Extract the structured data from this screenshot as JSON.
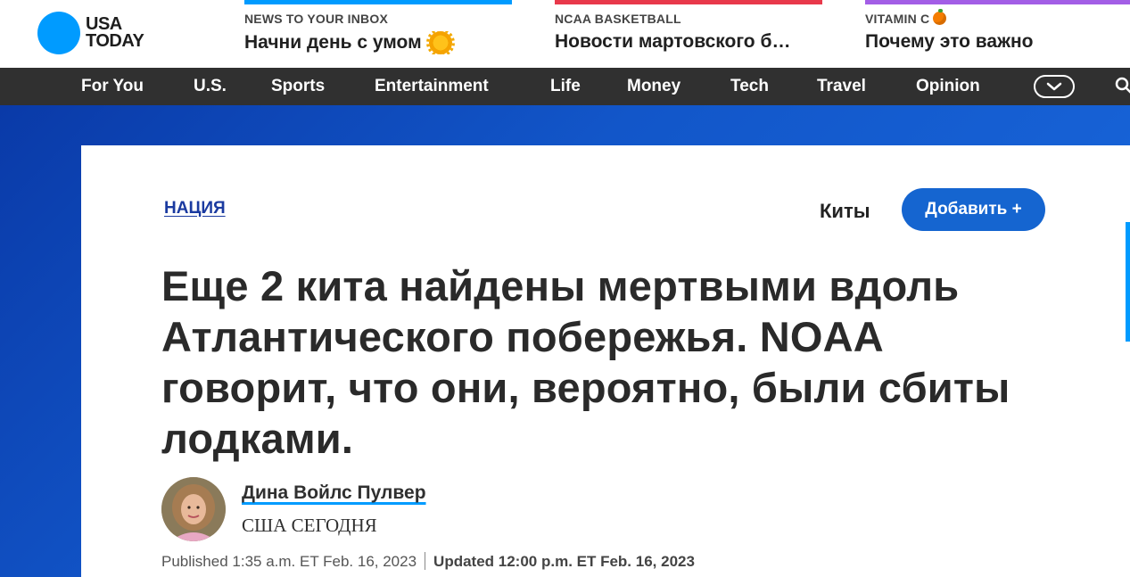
{
  "header": {
    "logo_line1": "USA",
    "logo_line2": "TODAY",
    "promos": [
      {
        "kicker": "NEWS TO YOUR INBOX",
        "title": "Начни день с умом",
        "bar_color": "#009bff",
        "icon": "sun-icon"
      },
      {
        "kicker": "NCAA BASKETBALL",
        "title": "Новости мартовского б…",
        "bar_color": "#e8394b",
        "icon": ""
      },
      {
        "kicker": "VITAMIN C",
        "title": "Почему это важно",
        "bar_color": "#a35ee6",
        "icon": "orange-icon"
      }
    ]
  },
  "nav": {
    "items": [
      "For You",
      "U.S.",
      "Sports",
      "Entertainment",
      "Life",
      "Money",
      "Tech",
      "Travel",
      "Opinion"
    ],
    "more_icon": "chevron-down-icon",
    "search_icon": "search-icon"
  },
  "article": {
    "section": "НАЦИЯ",
    "topic": "Киты",
    "add_button": "Добавить +",
    "headline": "Еще 2 кита найдены мертвыми вдоль Атлантического побережья. NOAA говорит, что они, вероятно, были сбиты лодками.",
    "author": {
      "name": "Дина Войлс Пулвер",
      "org": "США СЕГОДНЯ"
    },
    "published": "Published 1:35 a.m. ET Feb. 16, 2023",
    "updated": "Updated 12:00 p.m. ET Feb. 16, 2023"
  },
  "colors": {
    "accent": "#009bff",
    "nav_bg": "#303030",
    "button": "#1565d0",
    "hero": "#1256c9"
  }
}
